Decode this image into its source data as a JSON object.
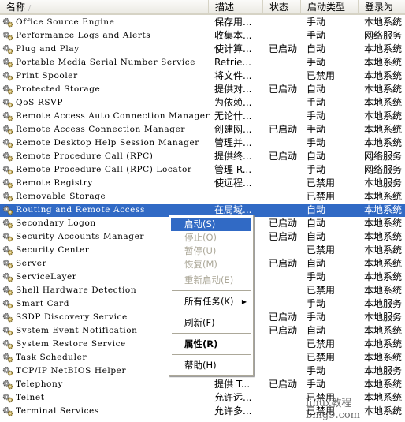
{
  "header": {
    "name": "名称",
    "desc": "描述",
    "status": "状态",
    "startup": "启动类型",
    "logon": "登录为"
  },
  "rows": [
    {
      "name": "Office Source Engine",
      "desc": "保存用...",
      "status": "",
      "startup": "手动",
      "logon": "本地系统"
    },
    {
      "name": "Performance Logs and Alerts",
      "desc": "收集本...",
      "status": "",
      "startup": "手动",
      "logon": "网络服务"
    },
    {
      "name": "Plug and Play",
      "desc": "使计算...",
      "status": "已启动",
      "startup": "自动",
      "logon": "本地系统"
    },
    {
      "name": "Portable Media Serial Number Service",
      "desc": "Retrie...",
      "status": "",
      "startup": "手动",
      "logon": "本地系统"
    },
    {
      "name": "Print Spooler",
      "desc": "将文件...",
      "status": "",
      "startup": "已禁用",
      "logon": "本地系统"
    },
    {
      "name": "Protected Storage",
      "desc": "提供对...",
      "status": "已启动",
      "startup": "自动",
      "logon": "本地系统"
    },
    {
      "name": "QoS RSVP",
      "desc": "为依赖...",
      "status": "",
      "startup": "手动",
      "logon": "本地系统"
    },
    {
      "name": "Remote Access Auto Connection Manager",
      "desc": "无论什...",
      "status": "",
      "startup": "手动",
      "logon": "本地系统"
    },
    {
      "name": "Remote Access Connection Manager",
      "desc": "创建网...",
      "status": "已启动",
      "startup": "手动",
      "logon": "本地系统"
    },
    {
      "name": "Remote Desktop Help Session Manager",
      "desc": "管理并...",
      "status": "",
      "startup": "手动",
      "logon": "本地系统"
    },
    {
      "name": "Remote Procedure Call (RPC)",
      "desc": "提供终...",
      "status": "已启动",
      "startup": "自动",
      "logon": "网络服务"
    },
    {
      "name": "Remote Procedure Call (RPC) Locator",
      "desc": "管理 R...",
      "status": "",
      "startup": "手动",
      "logon": "网络服务"
    },
    {
      "name": "Remote Registry",
      "desc": "使远程...",
      "status": "",
      "startup": "已禁用",
      "logon": "本地服务"
    },
    {
      "name": "Removable Storage",
      "desc": "",
      "status": "",
      "startup": "已禁用",
      "logon": "本地系统"
    },
    {
      "name": "Routing and Remote Access",
      "desc": "在局域...",
      "status": "",
      "startup": "自动",
      "logon": "本地系统"
    },
    {
      "name": "Secondary Logon",
      "desc": "",
      "status": "已启动",
      "startup": "自动",
      "logon": "本地系统"
    },
    {
      "name": "Security Accounts Manager",
      "desc": "",
      "status": "已启动",
      "startup": "自动",
      "logon": "本地系统"
    },
    {
      "name": "Security Center",
      "desc": "",
      "status": "",
      "startup": "已禁用",
      "logon": "本地系统"
    },
    {
      "name": "Server",
      "desc": "",
      "status": "已启动",
      "startup": "自动",
      "logon": "本地系统"
    },
    {
      "name": "ServiceLayer",
      "desc": "",
      "status": "",
      "startup": "手动",
      "logon": "本地系统"
    },
    {
      "name": "Shell Hardware Detection",
      "desc": "",
      "status": "",
      "startup": "已禁用",
      "logon": "本地系统"
    },
    {
      "name": "Smart Card",
      "desc": "",
      "status": "",
      "startup": "手动",
      "logon": "本地服务"
    },
    {
      "name": "SSDP Discovery Service",
      "desc": "",
      "status": "已启动",
      "startup": "手动",
      "logon": "本地服务"
    },
    {
      "name": "System Event Notification",
      "desc": "",
      "status": "已启动",
      "startup": "自动",
      "logon": "本地系统"
    },
    {
      "name": "System Restore Service",
      "desc": "",
      "status": "",
      "startup": "已禁用",
      "logon": "本地系统"
    },
    {
      "name": "Task Scheduler",
      "desc": "",
      "status": "",
      "startup": "已禁用",
      "logon": "本地系统"
    },
    {
      "name": "TCP/IP NetBIOS Helper",
      "desc": "",
      "status": "",
      "startup": "手动",
      "logon": "本地服务"
    },
    {
      "name": "Telephony",
      "desc": "提供 T...",
      "status": "已启动",
      "startup": "手动",
      "logon": "本地系统"
    },
    {
      "name": "Telnet",
      "desc": "允许远...",
      "status": "",
      "startup": "已禁用",
      "logon": "本地系统"
    },
    {
      "name": "Terminal Services",
      "desc": "允许多...",
      "status": "",
      "startup": "已禁用",
      "logon": "本地系统"
    }
  ],
  "selected_index": 14,
  "menu": {
    "start": "启动(S)",
    "stop": "停止(O)",
    "pause": "暂停(U)",
    "resume": "恢复(M)",
    "restart": "重新启动(E)",
    "all_tasks": "所有任务(K)",
    "refresh": "刷新(F)",
    "properties": "属性(R)",
    "help": "帮助(H)"
  },
  "watermark": "linux教程 bing9.com",
  "colors": {
    "selection": "#316ac5"
  }
}
